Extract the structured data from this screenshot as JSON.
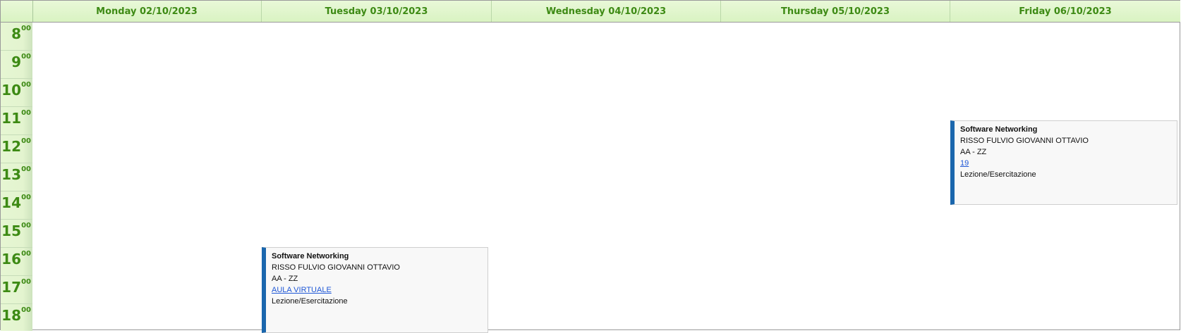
{
  "days": [
    {
      "label": "Monday 02/10/2023"
    },
    {
      "label": "Tuesday 03/10/2023"
    },
    {
      "label": "Wednesday 04/10/2023"
    },
    {
      "label": "Thursday 05/10/2023"
    },
    {
      "label": "Friday 06/10/2023"
    }
  ],
  "hours": [
    {
      "h": "8",
      "m": "00"
    },
    {
      "h": "9",
      "m": "00"
    },
    {
      "h": "10",
      "m": "00"
    },
    {
      "h": "11",
      "m": "00"
    },
    {
      "h": "12",
      "m": "00"
    },
    {
      "h": "13",
      "m": "00"
    },
    {
      "h": "14",
      "m": "00"
    },
    {
      "h": "15",
      "m": "00"
    },
    {
      "h": "16",
      "m": "00"
    },
    {
      "h": "17",
      "m": "00"
    },
    {
      "h": "18",
      "m": "00"
    }
  ],
  "events": [
    {
      "day": "Friday 06/10/2023",
      "title": "Software Networking",
      "teacher": "RISSO FULVIO GIOVANNI OTTAVIO",
      "group": "AA - ZZ",
      "room": "19",
      "type": "Lezione/Esercitazione"
    },
    {
      "day": "Tuesday 03/10/2023",
      "title": "Software Networking",
      "teacher": "RISSO FULVIO GIOVANNI OTTAVIO",
      "group": "AA - ZZ",
      "room": "AULA VIRTUALE",
      "type": "Lezione/Esercitazione"
    }
  ],
  "colors": {
    "header_text": "#3d8a14",
    "event_accent": "#1a66ad",
    "link": "#1f57d6"
  }
}
